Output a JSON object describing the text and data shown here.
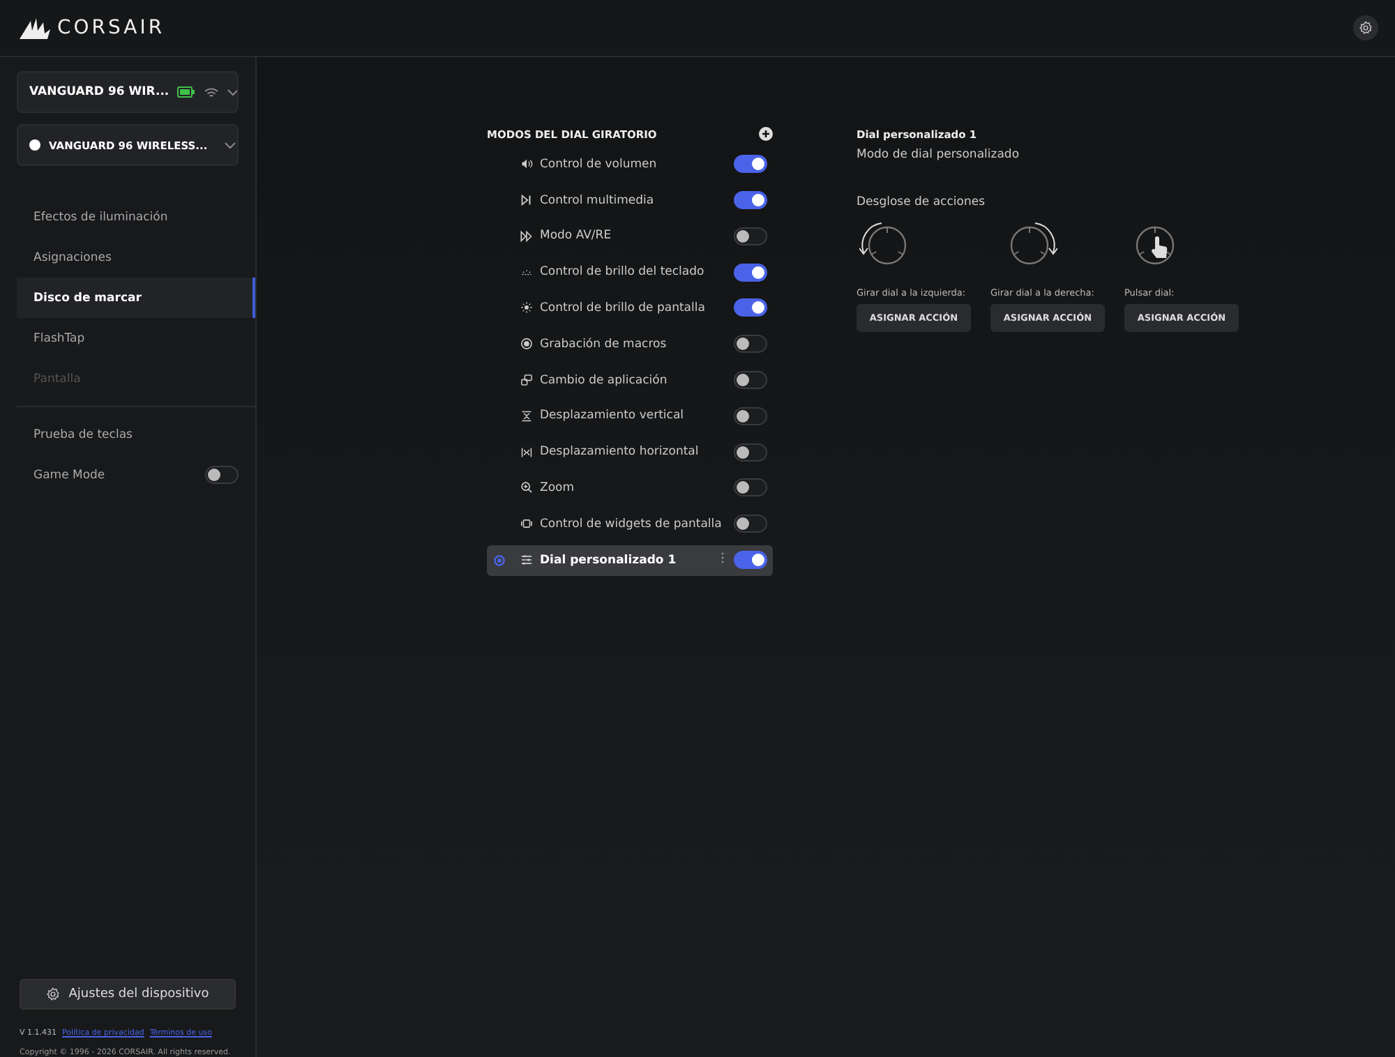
{
  "app": {
    "logo": "CORSAIR"
  },
  "device_selector": {
    "label": "VANGUARD 96 WIR..."
  },
  "profile_selector": {
    "label": "VANGUARD 96 WIRELESS..."
  },
  "sidebar": {
    "items": [
      {
        "label": "Efectos de iluminación",
        "selected": false,
        "disabled": false
      },
      {
        "label": "Asignaciones",
        "selected": false,
        "disabled": false
      },
      {
        "label": "Disco de marcar",
        "selected": true,
        "disabled": false
      },
      {
        "label": "FlashTap",
        "selected": false,
        "disabled": false
      },
      {
        "label": "Pantalla",
        "selected": false,
        "disabled": true
      }
    ],
    "extra_items": [
      {
        "label": "Prueba de teclas",
        "kind": "link"
      },
      {
        "label": "Game Mode",
        "kind": "toggle",
        "on": false
      }
    ],
    "settings_button": "Ajustes del dispositivo",
    "version": "V 1.1.431",
    "links": [
      "Política de privacidad",
      "Términos de uso"
    ],
    "copyright": "Copyright © 1996 - 2026 CORSAIR. All rights reserved."
  },
  "modes": {
    "title": "MODOS DEL DIAL GIRATORIO",
    "items": [
      {
        "label": "Control de volumen",
        "on": true,
        "selected": false
      },
      {
        "label": "Control multimedia",
        "on": true,
        "selected": false
      },
      {
        "label": "Modo AV/RE",
        "on": false,
        "selected": false
      },
      {
        "label": "Control de brillo del teclado",
        "on": true,
        "selected": false
      },
      {
        "label": "Control de brillo de pantalla",
        "on": true,
        "selected": false
      },
      {
        "label": "Grabación de macros",
        "on": false,
        "selected": false
      },
      {
        "label": "Cambio de aplicación",
        "on": false,
        "selected": false
      },
      {
        "label": "Desplazamiento vertical",
        "on": false,
        "selected": false
      },
      {
        "label": "Desplazamiento horizontal",
        "on": false,
        "selected": false
      },
      {
        "label": "Zoom",
        "on": false,
        "selected": false
      },
      {
        "label": "Control de widgets de pantalla",
        "on": false,
        "selected": false
      },
      {
        "label": "Dial personalizado 1",
        "on": true,
        "selected": true
      }
    ]
  },
  "detail": {
    "title": "Dial personalizado 1",
    "subtitle": "Modo de dial personalizado",
    "section": "Desglose de acciones",
    "actions": [
      {
        "kind": "rotate_left",
        "label": "Girar dial a la izquierda:",
        "button": "ASIGNAR ACCIÓN"
      },
      {
        "kind": "rotate_right",
        "label": "Girar dial a la derecha:",
        "button": "ASIGNAR ACCIÓN"
      },
      {
        "kind": "press",
        "label": "Pulsar dial:",
        "button": "ASIGNAR ACCIÓN"
      }
    ]
  }
}
